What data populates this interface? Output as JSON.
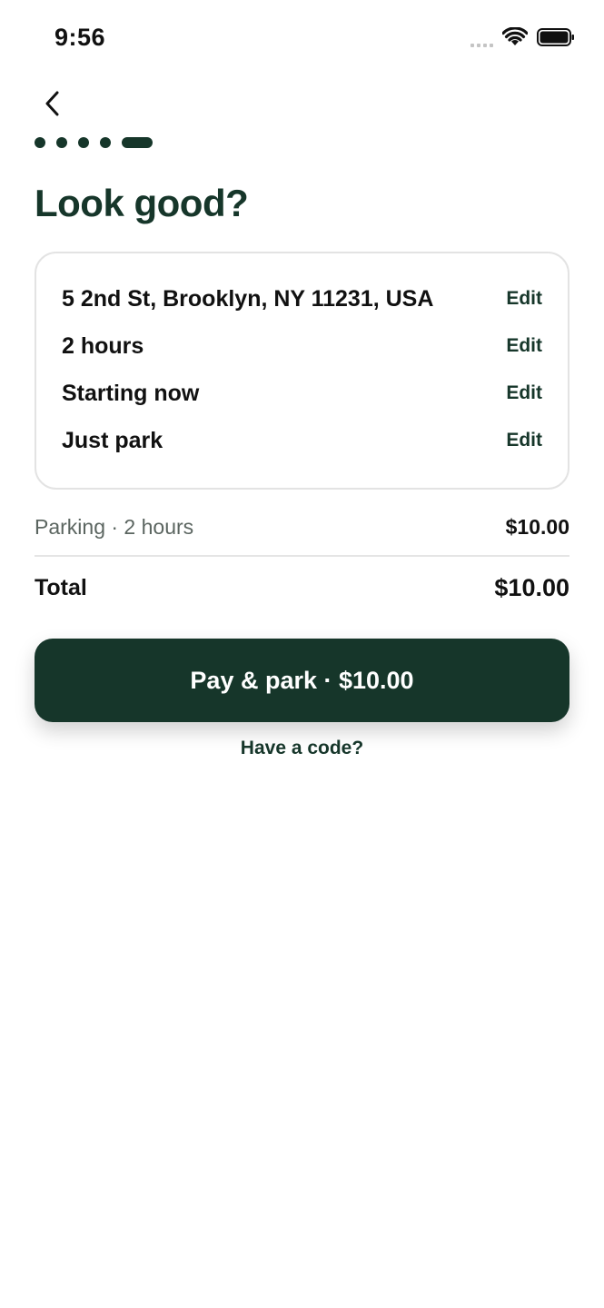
{
  "status_bar": {
    "time": "9:56",
    "icons": [
      "signal-icon",
      "wifi-icon",
      "battery-icon"
    ]
  },
  "nav": {
    "back_icon": "chevron-left-icon"
  },
  "progress": {
    "total_steps": 5,
    "current_step": 5
  },
  "title": "Look good?",
  "summary": {
    "rows": [
      {
        "text": "5 2nd St, Brooklyn, NY 11231, USA",
        "action": "Edit"
      },
      {
        "text": "2 hours",
        "action": "Edit"
      },
      {
        "text": "Starting now",
        "action": "Edit"
      },
      {
        "text": "Just park",
        "action": "Edit"
      }
    ]
  },
  "pricing": {
    "line_label": "Parking · 2 hours",
    "line_amount": "$10.00",
    "total_label": "Total",
    "total_amount": "$10.00"
  },
  "actions": {
    "pay_label": "Pay & park · $10.00",
    "code_label": "Have a code?"
  },
  "colors": {
    "brand": "#16362a",
    "text": "#111111",
    "muted": "#5b6560",
    "border": "#e3e3e3"
  }
}
